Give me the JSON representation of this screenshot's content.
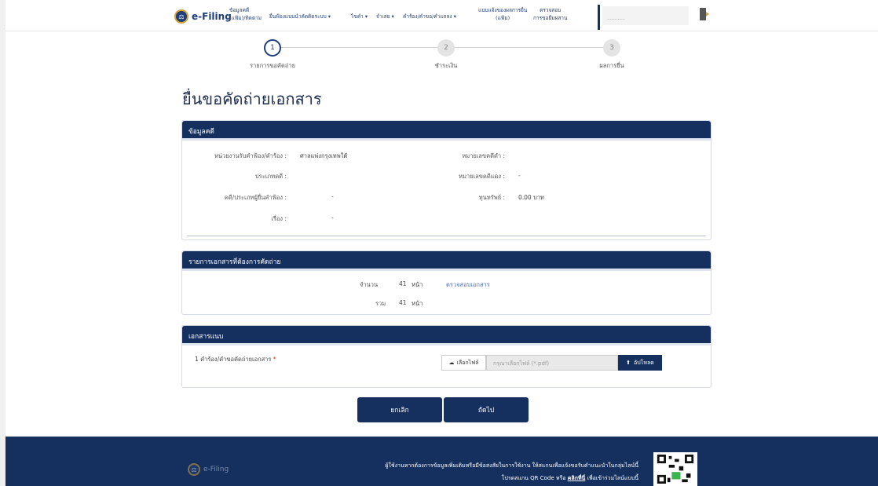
{
  "header": {
    "logo_text": "e-Filing",
    "nav": [
      {
        "line1": "ข้อมูลคดี",
        "line2": "(แฟ้ม)/ทิดตาม"
      },
      {
        "line1": "ยื่นฟ้องแบบนำคัดติดระบบ ▾",
        "line2": ""
      },
      {
        "line1": "ไขคำ ▾",
        "line2": ""
      },
      {
        "line1": "จำเลย ▾",
        "line2": ""
      },
      {
        "line1": "คำร้อง/คำขอ/คำแถลง ▾",
        "line2": ""
      },
      {
        "line1": "แบบแจ้งของผลการยื่น",
        "line2": "(แฟ้ม)"
      },
      {
        "line1": "ตรวจสอบ",
        "line2": "การขอยืมผสาน"
      }
    ],
    "user_placeholder": "............"
  },
  "stepper": [
    {
      "num": "1",
      "label": "รายการขอคัดถ่าย",
      "active": true
    },
    {
      "num": "2",
      "label": "ชำระเงิน",
      "active": false
    },
    {
      "num": "3",
      "label": "ผลการยื่น",
      "active": false
    }
  ],
  "page_title": "ยื่นขอคัดถ่ายเอกสาร",
  "case_info": {
    "heading": "ข้อมูลคดี",
    "court_label": "หน่วยงานรับคำฟ้อง/คำร้อง :",
    "court_value": "ศาลแพ่งกรุงเทพใต้",
    "black_no_label": "หมายเลขคดีดำ :",
    "type_label": "ประเภทคดี :",
    "red_no_label": "หมายเลขคดีแดง :",
    "red_no_value": "-",
    "parties_label": "คดี/ประเภทผู้ยื่นคำฟ้อง :",
    "parties_value": "-",
    "capital_label": "ทุนทรัพย์ :",
    "capital_value": "0.00 บาท",
    "subject_label": "เรื่อง :",
    "subject_value": "-"
  },
  "docs": {
    "heading": "รายการเอกสารที่ต้องการคัดถ่าย",
    "count_label": "จำนวน",
    "count_value": "41",
    "unit": "หน้า",
    "check_link": "ตรวจสอบเอกสาร",
    "total_label": "รวม",
    "total_value": "41",
    "total_unit": "หน้า"
  },
  "attach": {
    "heading": "เอกสารแนบ",
    "item_label": "1 คำร้อง/คำขอคัดถ่ายเอกสาร",
    "required_mark": "*",
    "file_button": "เลือกไฟล์",
    "file_placeholder": "กรุณาเลือกไฟล์ (*.pdf)",
    "upload_button": "อัปโหลด"
  },
  "actions": {
    "cancel": "ยกเลิก",
    "next": "ถัดไป"
  },
  "footer": {
    "logo_text": "e-Filing",
    "line1": "ผู้ใช้งานหากต้องการข้อมูลเพิ่มเติมหรือมีข้อสงสัยในการใช้งาน ให้สแกนเพื่อแจ้งขอรับคำแนะนำในกลุ่มไลน์นี้",
    "line2_pre": "โปรดสแกน QR Code หรือ",
    "line2_link": "คลิกที่นี่",
    "line2_post": "เพื่อเข้าร่วมไลน์แบบนี้"
  },
  "colors": {
    "navy": "#15305f",
    "accent_link": "#4a6fb5",
    "required": "#d0342c"
  }
}
